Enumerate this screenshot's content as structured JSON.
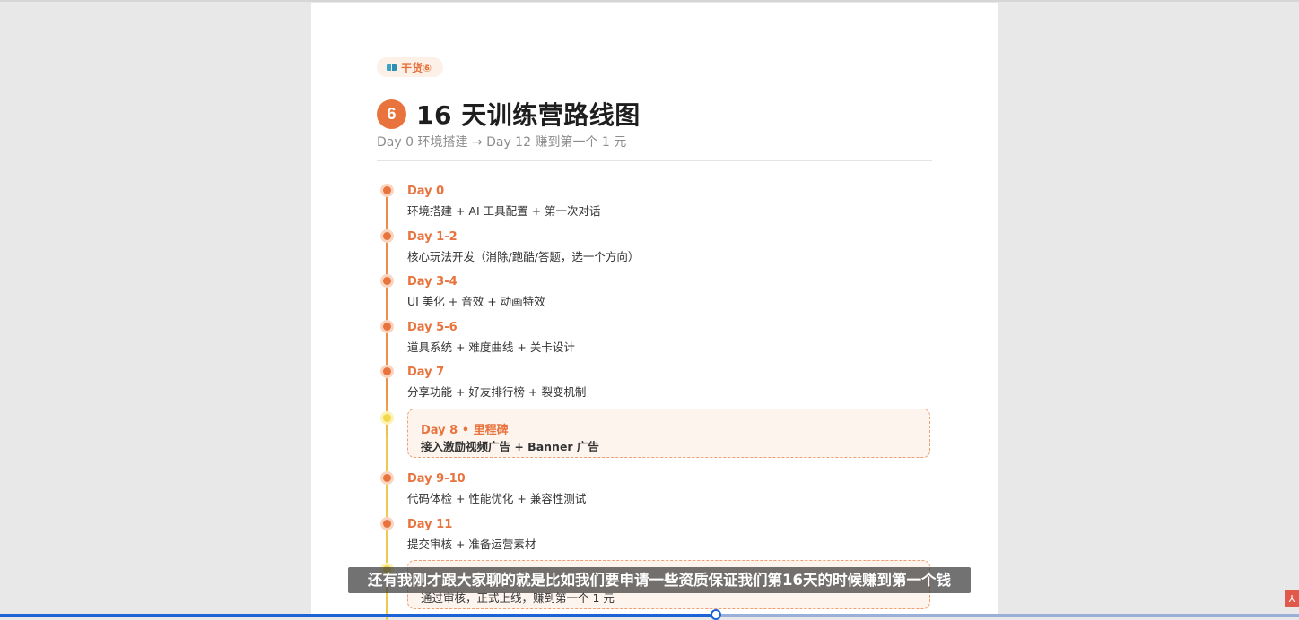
{
  "badge": {
    "icon": "book-icon",
    "label": "干货⑥"
  },
  "header": {
    "number": "6",
    "title": "16 天训练营路线图",
    "subtitle": "Day 0 环境搭建 → Day 12 赚到第一个 1 元"
  },
  "timeline": [
    {
      "day": "Day 0",
      "desc": "环境搭建 + AI 工具配置 + 第一次对话"
    },
    {
      "day": "Day 1-2",
      "desc": "核心玩法开发（消除/跑酷/答题，选一个方向）"
    },
    {
      "day": "Day 3-4",
      "desc": "UI 美化 + 音效 + 动画特效"
    },
    {
      "day": "Day 5-6",
      "desc": "道具系统 + 难度曲线 + 关卡设计"
    },
    {
      "day": "Day 7",
      "desc": "分享功能 + 好友排行榜 + 裂变机制"
    },
    {
      "day": "Day 8 • 里程碑",
      "desc": "接入激励视频广告 + Banner 广告",
      "milestone": true
    },
    {
      "day": "Day 9-10",
      "desc": "代码体检 + 性能优化 + 兼容性测试"
    },
    {
      "day": "Day 11",
      "desc": "提交审核 + 准备运营素材"
    },
    {
      "day": "",
      "desc": "通过审核，正式上线，赚到第一个 1 元",
      "milestone": true
    }
  ],
  "caption": "还有我刚才跟大家聊的就是比如我们要申请一些资质保证我们第16天的时候赚到第一个钱",
  "video": {
    "progress": 0.551
  },
  "colors": {
    "accent": "#e8733d",
    "milestone_bg": "#fdf4ee",
    "progress": "#1e63d6"
  }
}
